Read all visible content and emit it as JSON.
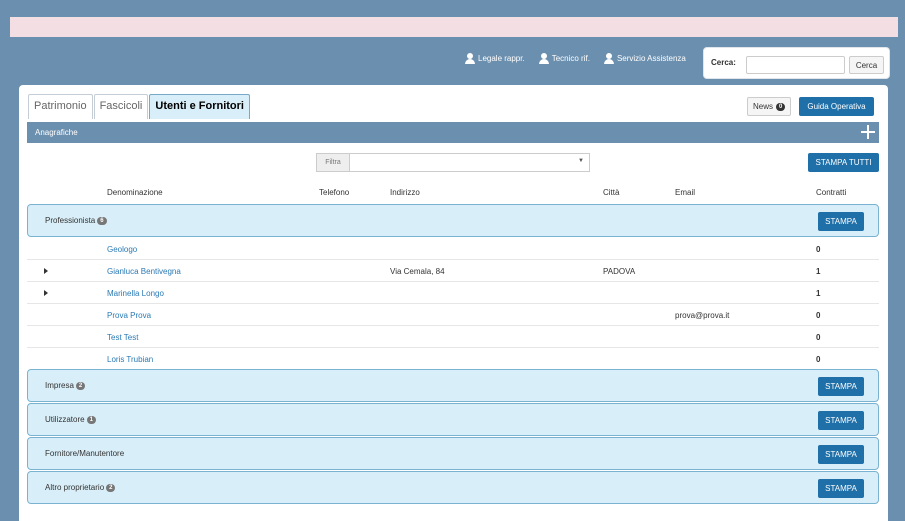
{
  "header": {
    "links": [
      {
        "label": "Legale rappr.",
        "icon": "user-icon"
      },
      {
        "label": "Tecnico rif.",
        "icon": "user-icon"
      },
      {
        "label": "Servizio Assistenza",
        "icon": "user-icon"
      }
    ],
    "search": {
      "label": "Cerca:",
      "value": "",
      "button": "Cerca"
    }
  },
  "tabs": [
    {
      "label": "Patrimonio",
      "active": false
    },
    {
      "label": "Fascicoli",
      "active": false
    },
    {
      "label": "Utenti e Fornitori",
      "active": true
    }
  ],
  "news": {
    "label": "News",
    "count": "0"
  },
  "guida_label": "Guida Operativa",
  "section": {
    "title": "Anagrafiche"
  },
  "filter": {
    "label": "Filtra",
    "value": ""
  },
  "stampa_tutti": "STAMPA TUTTI",
  "columns": {
    "denominazione": "Denominazione",
    "telefono": "Telefono",
    "indirizzo": "Indirizzo",
    "citta": "Città",
    "email": "Email",
    "contratti": "Contratti"
  },
  "groups": [
    {
      "name": "Professionista",
      "count": "6",
      "button": "STAMPA"
    },
    {
      "name": "Impresa",
      "count": "2",
      "button": "STAMPA"
    },
    {
      "name": "Utilizzatore",
      "count": "1",
      "button": "STAMPA"
    },
    {
      "name": "Fornitore/Manutentore",
      "count": "",
      "button": "STAMPA"
    },
    {
      "name": "Altro proprietario",
      "count": "2",
      "button": "STAMPA"
    }
  ],
  "rows": [
    {
      "name": "Geologo",
      "telefono": "",
      "indirizzo": "",
      "citta": "",
      "email": "",
      "contratti": "0",
      "expandable": false
    },
    {
      "name": "Gianluca Bentivegna",
      "telefono": "",
      "indirizzo": "Via Cemala, 84",
      "citta": "PADOVA",
      "email": "",
      "contratti": "1",
      "expandable": true
    },
    {
      "name": "Marinella Longo",
      "telefono": "",
      "indirizzo": "",
      "citta": "",
      "email": "",
      "contratti": "1",
      "expandable": true
    },
    {
      "name": "Prova Prova",
      "telefono": "",
      "indirizzo": "",
      "citta": "",
      "email": "prova@prova.it",
      "contratti": "0",
      "expandable": false
    },
    {
      "name": "Test Test",
      "telefono": "",
      "indirizzo": "",
      "citta": "",
      "email": "",
      "contratti": "0",
      "expandable": false
    },
    {
      "name": "Loris Trubian",
      "telefono": "",
      "indirizzo": "",
      "citta": "",
      "email": "",
      "contratti": "0",
      "expandable": false
    }
  ],
  "colors": {
    "header_bg": "#6b8fae",
    "pink_strip": "#f3dfe3",
    "primary_button": "#1f6fa8",
    "group_bg": "#d8eef8",
    "link": "#2a7ab4"
  }
}
